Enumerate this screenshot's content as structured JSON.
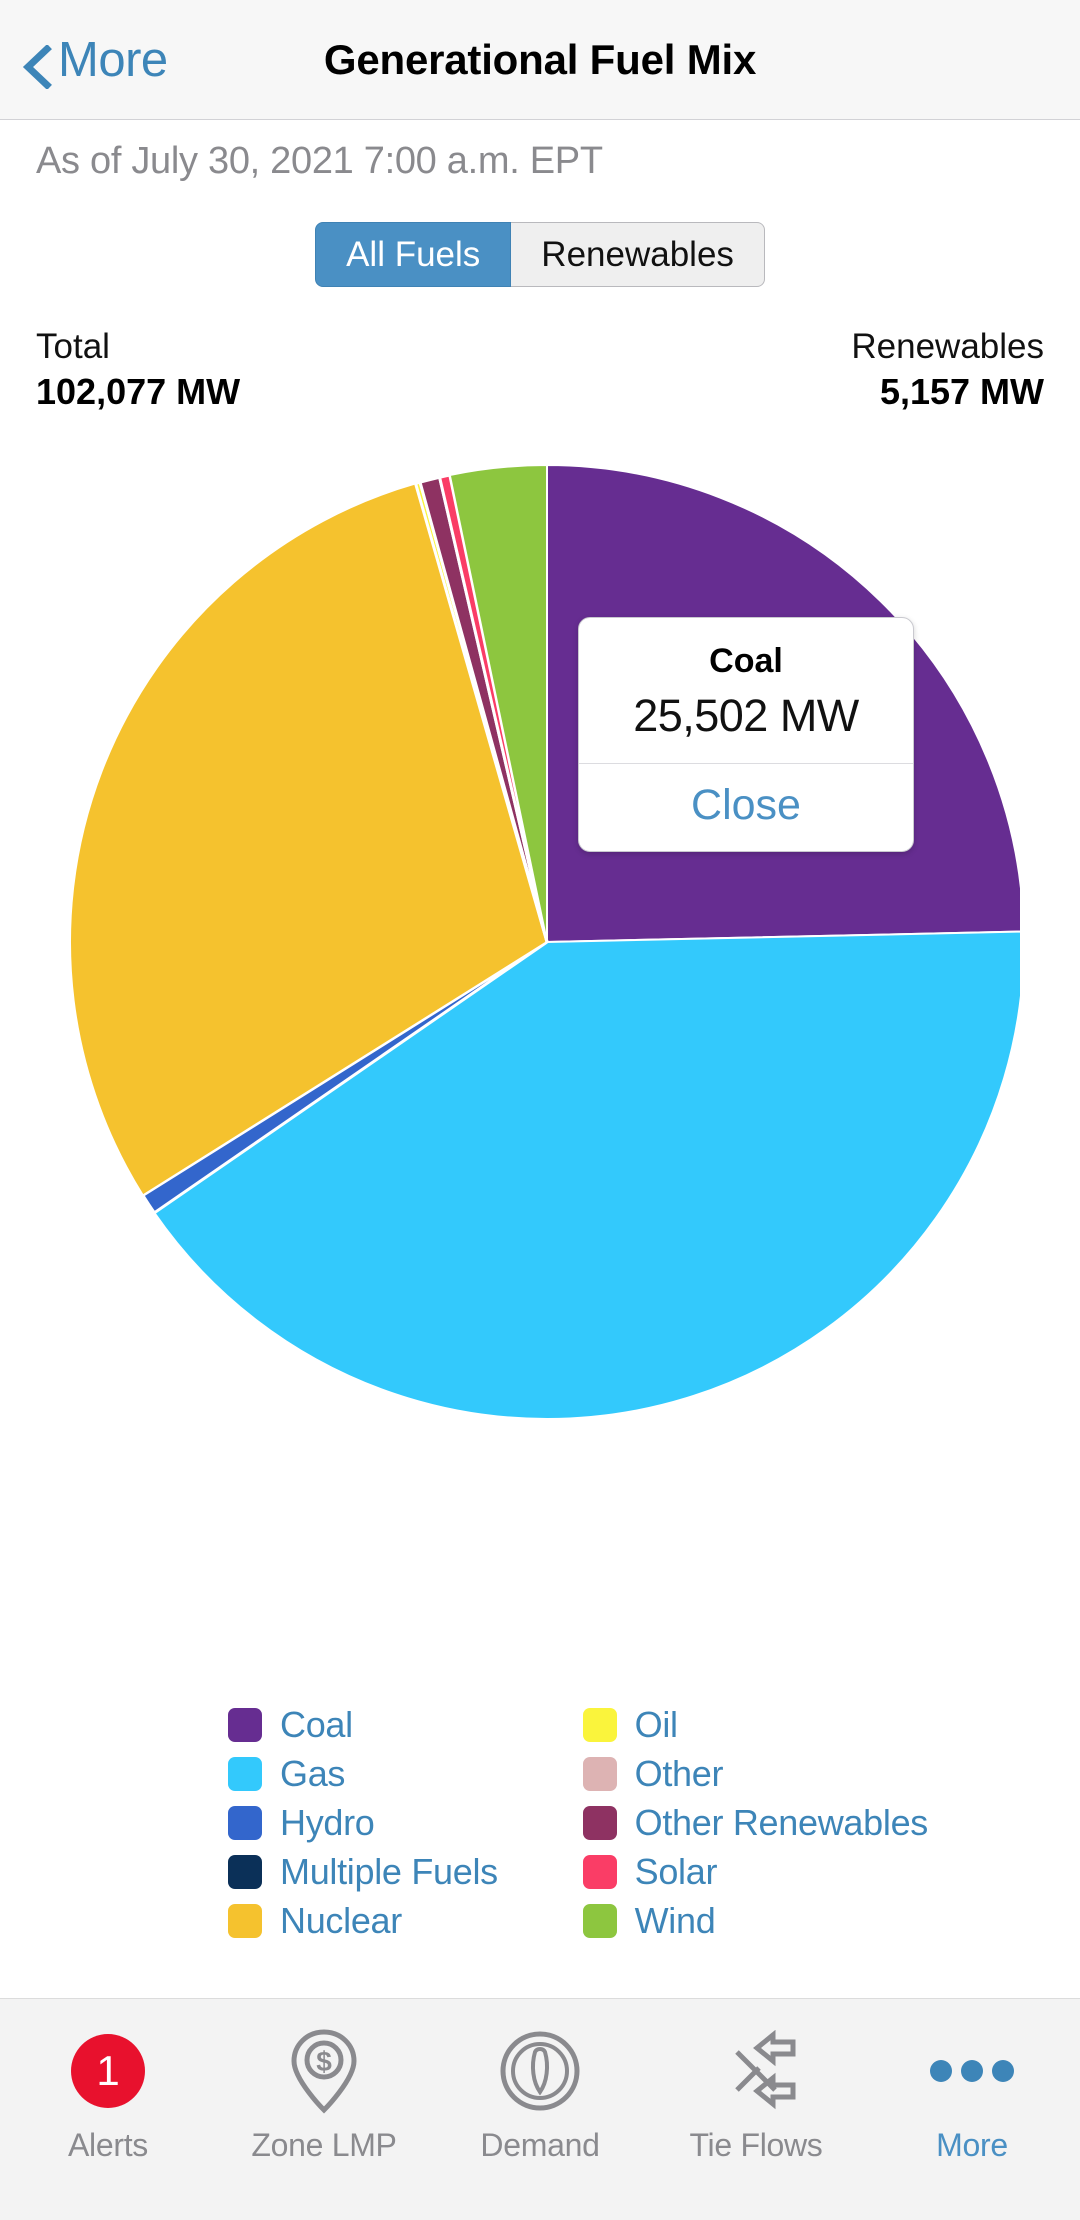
{
  "navbar": {
    "back_label": "More",
    "back_icon": "chevron-left-icon",
    "title": "Generational Fuel Mix"
  },
  "asof": "As of July 30, 2021 7:00 a.m. EPT",
  "segmented": {
    "options": [
      {
        "label": "All Fuels",
        "active": true
      },
      {
        "label": "Renewables",
        "active": false
      }
    ]
  },
  "totals": {
    "total_label": "Total",
    "total_value": "102,077 MW",
    "renewables_label": "Renewables",
    "renewables_value": "5,157 MW"
  },
  "callout": {
    "title": "Coal",
    "value": "25,502 MW",
    "close_label": "Close"
  },
  "legend": {
    "items": [
      {
        "label": "Coal",
        "color": "#662d91"
      },
      {
        "label": "Oil",
        "color": "#faf43c"
      },
      {
        "label": "Gas",
        "color": "#33c9fc"
      },
      {
        "label": "Other",
        "color": "#ddb3b3"
      },
      {
        "label": "Hydro",
        "color": "#3366cc"
      },
      {
        "label": "Other Renewables",
        "color": "#8e3262"
      },
      {
        "label": "Multiple Fuels",
        "color": "#0b3058"
      },
      {
        "label": "Solar",
        "color": "#fa3d66"
      },
      {
        "label": "Nuclear",
        "color": "#f5c22e"
      },
      {
        "label": "Wind",
        "color": "#8dc63f"
      }
    ]
  },
  "tabbar": {
    "tabs": [
      {
        "label": "Alerts",
        "icon": "alert-badge-icon",
        "badge": "1",
        "active": false
      },
      {
        "label": "Zone LMP",
        "icon": "map-pin-dollar-icon",
        "badge": null,
        "active": false
      },
      {
        "label": "Demand",
        "icon": "gauge-icon",
        "badge": null,
        "active": false
      },
      {
        "label": "Tie Flows",
        "icon": "tie-flows-arrows-icon",
        "badge": null,
        "active": false
      },
      {
        "label": "More",
        "icon": "ellipsis-icon",
        "badge": null,
        "active": true
      }
    ]
  },
  "chart_data": {
    "type": "pie",
    "title": "Generational Fuel Mix",
    "unit": "MW",
    "total": 102077,
    "renewables_total": 5157,
    "start_angle_deg": 0,
    "direction": "clockwise",
    "legend_position": "bottom",
    "selected_slice": "Coal",
    "categories": [
      "Coal",
      "Gas",
      "Hydro",
      "Nuclear",
      "Wind",
      "Solar",
      "Other Renewables",
      "Oil",
      "Multiple Fuels",
      "Other"
    ],
    "values": [
      25502,
      42150,
      720,
      30490,
      3380,
      360,
      697,
      160,
      0,
      0
    ],
    "percents": [
      24.98,
      41.29,
      0.71,
      29.87,
      3.31,
      0.35,
      0.68,
      0.16,
      0.0,
      0.0
    ],
    "slice_colors": [
      "#662d91",
      "#33c9fc",
      "#3366cc",
      "#f5c22e",
      "#8dc63f",
      "#fa3d66",
      "#8e3262",
      "#faf43c",
      "#0b3058",
      "#ddb3b3"
    ],
    "slice_order_clockwise_from_top": [
      "Coal",
      "Gas",
      "Hydro",
      "Nuclear",
      "Oil",
      "Other Renewables",
      "Solar",
      "Wind"
    ],
    "annotations": [
      {
        "slice": "Coal",
        "label": "Coal",
        "value_label": "25,502 MW"
      }
    ]
  },
  "colors": {
    "accent_blue": "#3d85b8",
    "segment_active": "#4a90c4",
    "badge_red": "#e8112d",
    "nav_bg": "#f7f7f7",
    "tabbar_bg": "#f3f3f3",
    "muted_text": "#8a8a8e"
  }
}
